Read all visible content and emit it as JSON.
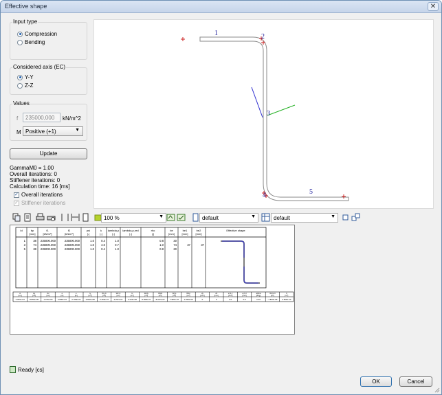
{
  "window": {
    "title": "Effective shape",
    "close_glyph": "✕"
  },
  "input_type": {
    "title": "Input type",
    "options": [
      {
        "label": "Compression",
        "selected": true
      },
      {
        "label": "Bending",
        "selected": false
      }
    ]
  },
  "axis": {
    "title": "Considered axis (EC)",
    "options": [
      {
        "label": "Y-Y",
        "selected": true
      },
      {
        "label": "Z-Z",
        "selected": false
      }
    ]
  },
  "values": {
    "title": "Values",
    "f_label": "f",
    "f_value": "235000,000",
    "f_unit": "kN/m^2",
    "m_label": "M",
    "m_value": "Positive (+1)"
  },
  "update_label": "Update",
  "results": {
    "gamma": "GammaM0 = 1.00",
    "overall_iter": "Overall iterations: 0",
    "stiffener_iter": "Stiffener iterations: 0",
    "calc_time": "Calculation time: 16 [ms]"
  },
  "checks": {
    "overall": {
      "label": "Overall iterations",
      "checked": true
    },
    "stiffener": {
      "label": "Stiffener iterations",
      "checked": true,
      "disabled": true
    }
  },
  "drawing": {
    "labels": [
      "1",
      "2",
      "3",
      "4",
      "5"
    ],
    "shape_color": "#8a8a8a",
    "label_color": "#1d1d9c",
    "marker_color": "#cc2222",
    "axis_color_a": "#2f2fd0",
    "axis_color_b": "#22b022"
  },
  "toolbar": {
    "zoom": "100 %",
    "style1": "default",
    "style2": "default",
    "icons": [
      "copy-icon",
      "export-icon",
      "print-icon",
      "page-portrait-icon",
      "page-width-icon",
      "page-icon",
      "color-swatch-icon",
      "refresh-icon",
      "refresh-check-icon",
      "page-style-icon",
      "table-style-icon",
      "grid-icon",
      "settings-icon"
    ]
  },
  "report": {
    "table1": {
      "headers": [
        "Id",
        "bp\n[mm]",
        "f1\n[kN/m²]",
        "f2\n[kN/m²]",
        "psi\n[-]",
        "k\n[-]",
        "lambda,p\n[-]",
        "lambda,p,red\n[-]",
        "rho\n[-]",
        "be\n[mm]",
        "be1\n[mm]",
        "be2\n[mm]",
        "Effective shape"
      ],
      "rows": [
        [
          "1",
          "38",
          "235000.000",
          "235000.000",
          "1.0",
          "0.4",
          "1.0",
          "",
          "0.8",
          "30",
          "",
          ""
        ],
        [
          "3",
          "74",
          "235000.000",
          "235000.000",
          "1.0",
          "4.0",
          "0.7",
          "",
          "1.0",
          "74",
          "37",
          "37"
        ],
        [
          "5",
          "38",
          "235000.000",
          "235000.000",
          "1.0",
          "0.4",
          "1.0",
          "",
          "0.8",
          "30",
          "",
          ""
        ]
      ]
    },
    "table2": {
      "headers": [
        "A\n[m²]",
        "Ay\n[m²]",
        "Az\n[m²]",
        "e\n[m]",
        "e\n[m]",
        "Iy\n[m⁴]",
        "Wy,C\n[m³]",
        "Wz,C\n[m³]",
        "Iz\n[m⁴]",
        "Wply\n[m³]",
        "Wplz\n[m³]",
        "Wyp\n[m³]",
        "Wzp\n[m³]",
        "dy\n[mm]",
        "dz\n[mm]",
        "e,N,y\n[mm]",
        "e,N,z\n[mm]",
        "alpha\n[deg]",
        "Wt,UN\n[m³]",
        "It\n[m⁴]"
      ],
      "row": [
        "2.091e-04",
        "8.854e-05",
        "1.376e-04",
        "3.090e-03",
        "2.768e-02",
        "3.822e-08",
        "2.463e-07",
        "4.297e-07",
        "4.124e-08",
        "8.395e-07",
        "8.047e-07",
        "7.987e-07",
        "1.034e-06",
        "0",
        "0",
        "0.0",
        "0.0",
        "15.0",
        "-7.843e-09",
        "2.500e-10"
      ]
    }
  },
  "status": "Ready [cs]",
  "ok_label": "OK",
  "cancel_label": "Cancel"
}
